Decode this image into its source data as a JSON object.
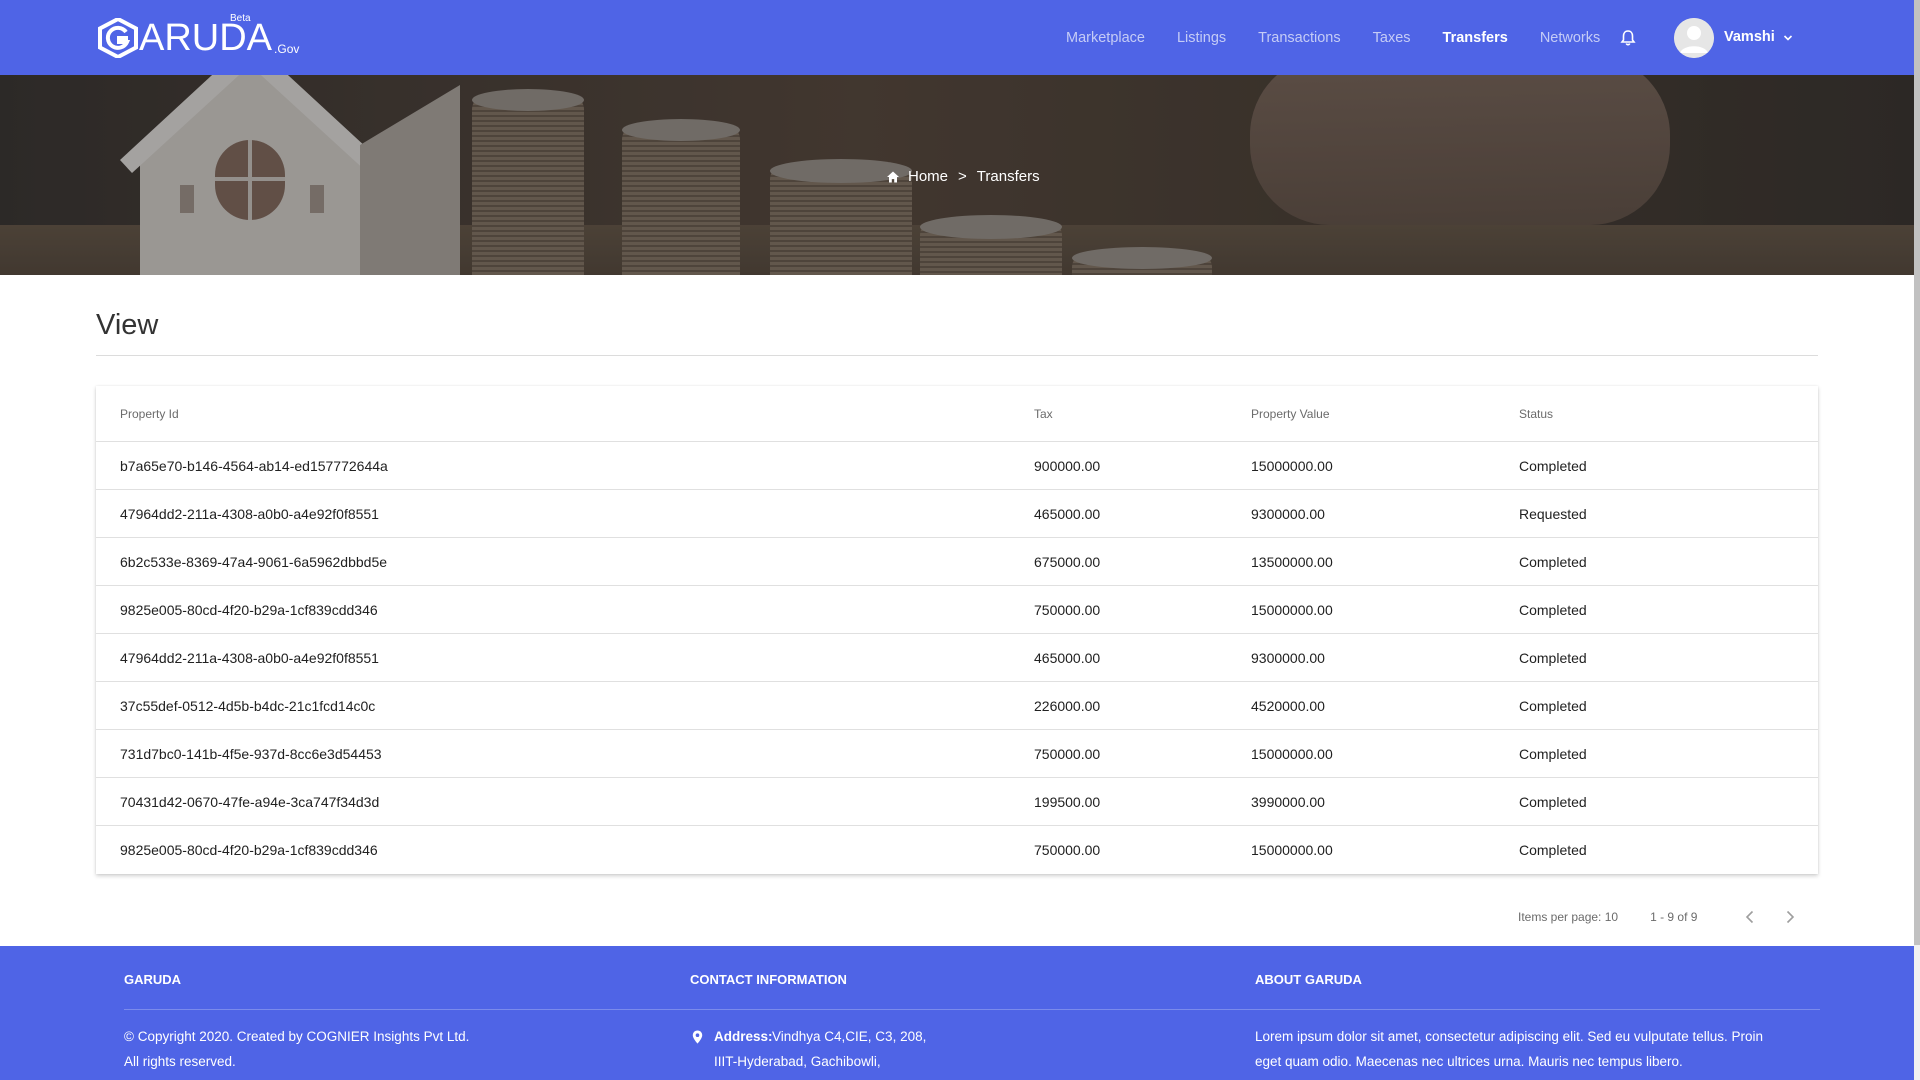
{
  "header": {
    "brand_word": "ARUDA",
    "brand_beta": "Beta",
    "brand_gov": ".Gov",
    "nav": [
      {
        "label": "Marketplace"
      },
      {
        "label": "Listings"
      },
      {
        "label": "Transactions"
      },
      {
        "label": "Taxes"
      },
      {
        "label": "Transfers",
        "active": true
      },
      {
        "label": "Networks"
      }
    ],
    "user_name": "Vamshi",
    "accent": "#4f64e6"
  },
  "breadcrumb": {
    "home": "Home",
    "separator": ">",
    "current": "Transfers"
  },
  "page_title": "View",
  "table": {
    "headers": [
      "Property Id",
      "Tax",
      "Property Value",
      "Status"
    ],
    "rows": [
      [
        "b7a65e70-b146-4564-ab14-ed157772644a",
        "900000.00",
        "15000000.00",
        "Completed"
      ],
      [
        "47964dd2-211a-4308-a0b0-a4e92f0f8551",
        "465000.00",
        "9300000.00",
        "Requested"
      ],
      [
        "6b2c533e-8369-47a4-9061-6a5962dbbd5e",
        "675000.00",
        "13500000.00",
        "Completed"
      ],
      [
        "9825e005-80cd-4f20-b29a-1cf839cdd346",
        "750000.00",
        "15000000.00",
        "Completed"
      ],
      [
        "47964dd2-211a-4308-a0b0-a4e92f0f8551",
        "465000.00",
        "9300000.00",
        "Completed"
      ],
      [
        "37c55def-0512-4d5b-b4dc-21c1fcd14c0c",
        "226000.00",
        "4520000.00",
        "Completed"
      ],
      [
        "731d7bc0-141b-4f5e-937d-8cc6e3d54453",
        "750000.00",
        "15000000.00",
        "Completed"
      ],
      [
        "70431d42-0670-47fe-a94e-3ca747f34d3d",
        "199500.00",
        "3990000.00",
        "Completed"
      ],
      [
        "9825e005-80cd-4f20-b29a-1cf839cdd346",
        "750000.00",
        "15000000.00",
        "Completed"
      ]
    ]
  },
  "paginator": {
    "items_per_page": "Items per page: 10",
    "range": "1 - 9 of 9"
  },
  "footer": {
    "col1_title": "GARUDA",
    "col1_line1": "© Copyright 2020. Created by COGNIER Insights Pvt Ltd.",
    "col1_line2": "All rights reserved.",
    "col2_title": "CONTACT INFORMATION",
    "col2_address_label": "Address:",
    "col2_address_line1": "Vindhya C4,CIE, C3, 208,",
    "col2_address_line2": "IIIT-Hyderabad, Gachibowli,",
    "col3_title": "ABOUT GARUDA",
    "col3_line1": "Lorem ipsum dolor sit amet, consectetur adipiscing elit. Sed eu vulputate tellus. Proin",
    "col3_line2": "eget quam odio. Maecenas nec ultrices urna. Mauris nec tempus libero."
  }
}
